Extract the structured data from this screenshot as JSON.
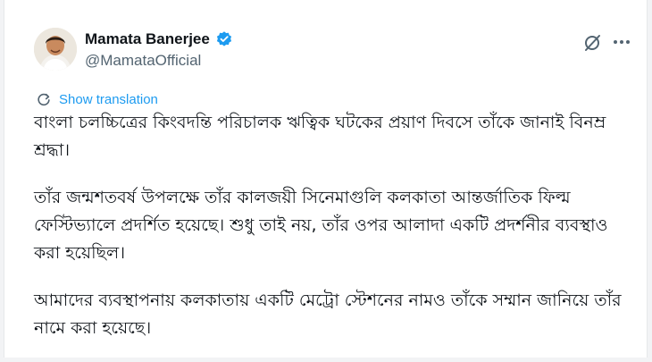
{
  "author": {
    "name": "Mamata Banerjee",
    "handle": "@MamataOfficial",
    "avatar_icon": "profile-photo",
    "verified_icon": "verified-badge-icon",
    "verified_color": "#1d9bf0"
  },
  "toolbar": {
    "grok_icon": "grok-icon",
    "more_icon": "more-dots-icon"
  },
  "translate": {
    "label": "Show translation",
    "icon": "translate-icon",
    "color": "#1d9bf0"
  },
  "tweet": {
    "paragraphs": [
      "বাংলা চলচ্চিত্রের কিংবদন্তি পরিচালক ঋত্বিক ঘটকের প্রয়াণ দিবসে তাঁকে জানাই বিনম্র শ্রদ্ধা।",
      "তাঁর জন্মশতবর্ষ উপলক্ষে তাঁর কালজয়ী সিনেমাগুলি কলকাতা আন্তর্জাতিক ফিল্ম ফেস্টিভ্যালে প্রদর্শিত হয়েছে। শুধু তাই নয়, তাঁর ওপর আলাদা একটি প্রদর্শনীর ব্যবস্থাও করা হয়েছিল।",
      "আমাদের ব্যবস্থাপনায় কলকাতায় একটি মেট্রো স্টেশনের নামও তাঁকে সম্মান জানিয়ে তাঁর নামে করা হয়েছে।"
    ]
  }
}
